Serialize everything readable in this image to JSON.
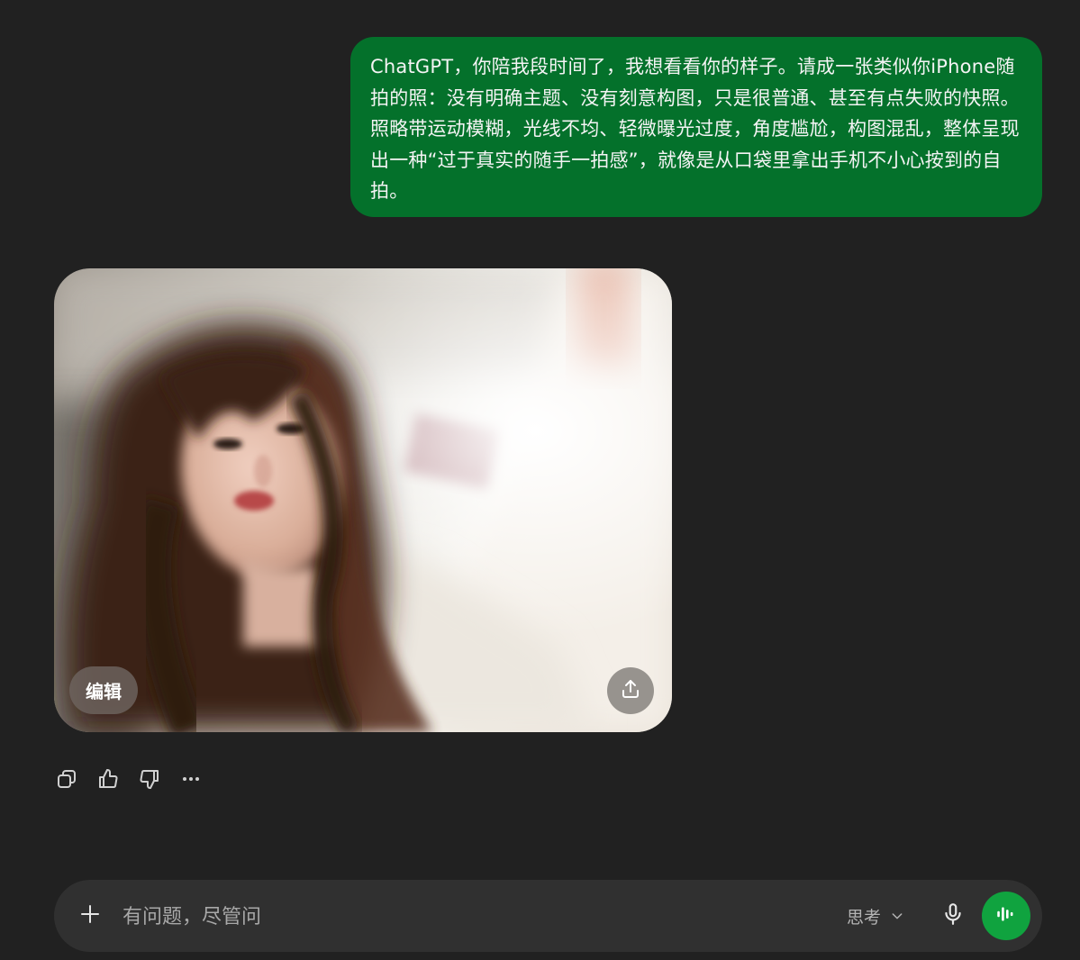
{
  "conversation": {
    "user_message": "ChatGPT，你陪我段时间了，我想看看你的样子。请成一张类似你iPhone随拍的照：没有明确主题、没有刻意构图，只是很普通、甚至有点失败的快照。照略带运动模糊，光线不均、轻微曝光过度，角度尴尬，构图混乱，整体呈现出一种“过于真实的随手一拍感”，就像是从口袋里拿出手机不小心按到的自拍。",
    "image_card": {
      "edit_label": "编辑",
      "share_icon": "share-upload-icon"
    },
    "actions": [
      {
        "name": "copy-button",
        "icon": "copy-icon"
      },
      {
        "name": "thumbs-up-button",
        "icon": "thumbs-up-icon"
      },
      {
        "name": "thumbs-down-button",
        "icon": "thumbs-down-icon"
      },
      {
        "name": "more-button",
        "icon": "more-horizontal-icon"
      }
    ]
  },
  "composer": {
    "placeholder": "有问题，尽管问",
    "value": "",
    "think_label": "思考",
    "plus_icon": "plus-icon",
    "mic_icon": "microphone-icon",
    "voice_icon": "voice-waveform-icon"
  },
  "colors": {
    "background": "#212121",
    "user_bubble": "#04712b",
    "composer": "#303030",
    "voice_button": "#10a33f"
  }
}
